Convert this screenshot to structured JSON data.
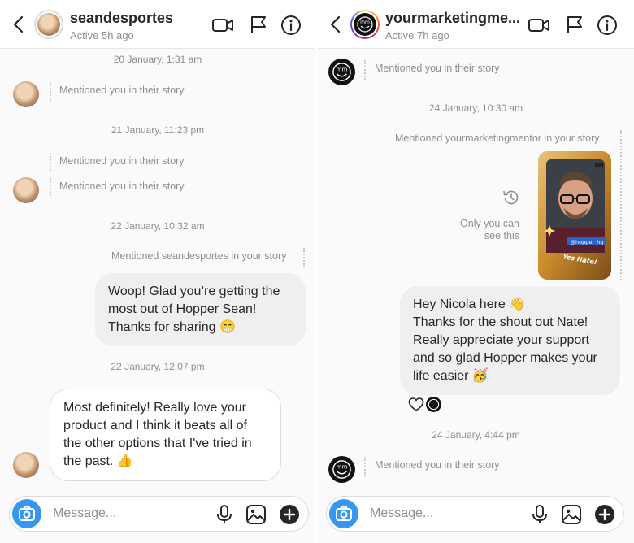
{
  "left": {
    "header": {
      "username": "seandesportes",
      "status": "Active 5h ago"
    },
    "timestamps": [
      "20 January, 1:31 am",
      "21 January, 11:23 pm",
      "22 January, 10:32 am",
      "22 January, 12:07 pm"
    ],
    "mentions": [
      "Mentioned you in their story",
      "Mentioned you in their story",
      "Mentioned you in their story"
    ],
    "outgoing_mention": "Mentioned seandesportes in your story",
    "sent_bubble": [
      "Woop! Glad you’re getting the",
      "most out of Hopper Sean!",
      "Thanks for sharing 😁"
    ],
    "received_bubble": [
      "Most definitely! Really love your",
      "product and I think it beats all of",
      "the other options that I've tried in",
      "the past. 👍"
    ],
    "composer": {
      "placeholder": "Message..."
    }
  },
  "right": {
    "header": {
      "username": "yourmarketingme...",
      "status": "Active 7h ago"
    },
    "timestamps": [
      "24 January, 10:30 am",
      "24 January, 4:44 pm"
    ],
    "mentions": [
      "Mentioned you in their story",
      "Mentioned you in their story"
    ],
    "outgoing_mention": "Mentioned yourmarketingmentor in your story",
    "only_you": [
      "Only you can",
      "see this"
    ],
    "story_tag": "@hopper_hq",
    "story_caption": "Yes Nate!",
    "sent_bubble": [
      "Hey Nicola here 👋",
      "Thanks for the shout out Nate!",
      "Really appreciate your support",
      "and so glad Hopper makes your",
      "life easier 🥳"
    ],
    "composer": {
      "placeholder": "Message..."
    }
  },
  "colors": {
    "accent": "#3797f0",
    "bubble_sent": "#efefef",
    "border": "#dbdbdb",
    "muted": "#8e8e8e"
  }
}
